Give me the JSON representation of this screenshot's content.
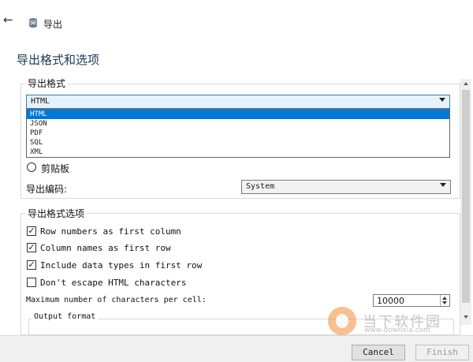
{
  "window": {
    "title": "导出",
    "back_icon": "back-arrow-icon",
    "app_icon": "database-icon"
  },
  "page": {
    "title": "导出格式和选项"
  },
  "format_group": {
    "legend": "导出格式",
    "selected": "HTML",
    "options": [
      "HTML",
      "JSON",
      "PDF",
      "SQL",
      "XML"
    ]
  },
  "output": {
    "clipboard_label": "剪贴板",
    "encoding_label": "导出编码:",
    "encoding_value": "System"
  },
  "options_group": {
    "legend": "导出格式选项",
    "checkboxes": [
      {
        "label": "Row numbers as first column",
        "checked": true
      },
      {
        "label": "Column names as first row",
        "checked": true
      },
      {
        "label": "Include data types in first row",
        "checked": true
      },
      {
        "label": "Don't escape HTML characters",
        "checked": false
      }
    ],
    "max_chars_label": "Maximum number of characters per cell:",
    "max_chars_value": "10000",
    "output_format_legend": "Output format"
  },
  "footer": {
    "cancel_label": "Cancel",
    "finish_label": "Finish"
  },
  "watermark": {
    "text": "当下软件园",
    "url": "www.downxia.com"
  }
}
